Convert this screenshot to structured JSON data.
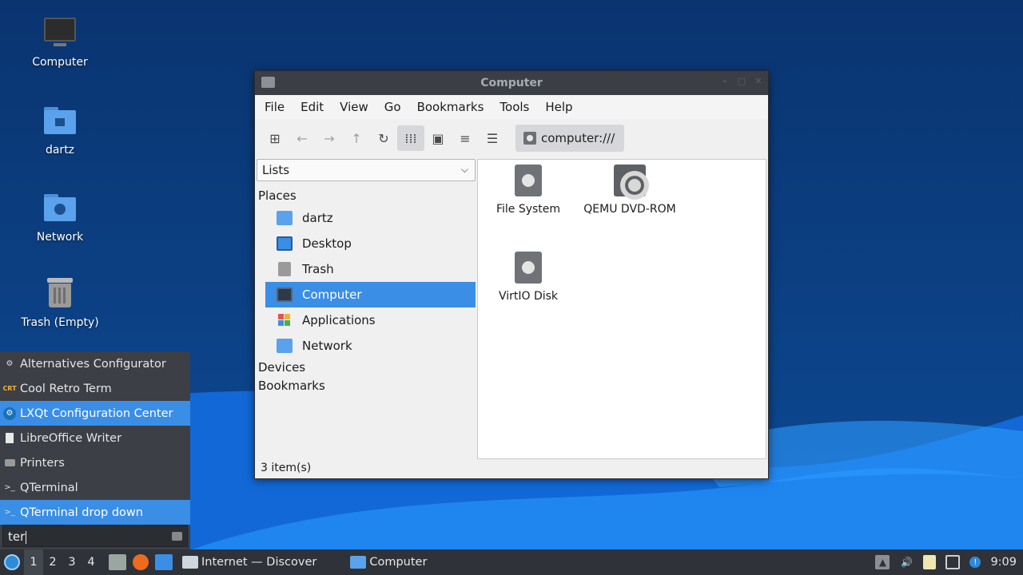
{
  "desktop": {
    "icons": [
      {
        "label": "Computer",
        "icon": "computer-icon"
      },
      {
        "label": "dartz",
        "icon": "home-folder-icon"
      },
      {
        "label": "Network",
        "icon": "network-folder-icon"
      },
      {
        "label": "Trash (Empty)",
        "icon": "trash-icon"
      }
    ]
  },
  "window": {
    "title": "Computer",
    "menu": [
      "File",
      "Edit",
      "View",
      "Go",
      "Bookmarks",
      "Tools",
      "Help"
    ],
    "toolbar": {
      "buttons": [
        "new-tab-icon",
        "back-icon",
        "forward-icon",
        "up-icon",
        "reload-icon",
        "icon-view-icon",
        "thumbnail-view-icon",
        "compact-view-icon",
        "detailed-list-icon"
      ],
      "path": "computer:///"
    },
    "sidebar": {
      "select_value": "Lists",
      "places_header": "Places",
      "items": [
        {
          "label": "dartz",
          "icon": "home-folder-icon"
        },
        {
          "label": "Desktop",
          "icon": "desktop-icon"
        },
        {
          "label": "Trash",
          "icon": "trash-icon"
        },
        {
          "label": "Computer",
          "icon": "computer-icon",
          "selected": true
        },
        {
          "label": "Applications",
          "icon": "applications-icon"
        },
        {
          "label": "Network",
          "icon": "network-folder-icon"
        }
      ],
      "devices_header": "Devices",
      "bookmarks_header": "Bookmarks"
    },
    "files": [
      {
        "label": "File System",
        "icon": "hard-drive-icon"
      },
      {
        "label": "QEMU DVD-ROM",
        "icon": "optical-drive-icon"
      },
      {
        "label": "VirtIO Disk",
        "icon": "hard-drive-icon"
      }
    ],
    "status": "3 item(s)"
  },
  "launcher": {
    "items": [
      {
        "label": "Alternatives Configurator",
        "icon": "configurator-icon"
      },
      {
        "label": "Cool Retro Term",
        "icon": "crt-icon"
      },
      {
        "label": "LXQt Configuration Center",
        "icon": "lxqt-config-icon",
        "highlighted": true
      },
      {
        "label": "LibreOffice Writer",
        "icon": "writer-icon"
      },
      {
        "label": "Printers",
        "icon": "printer-icon"
      },
      {
        "label": "QTerminal",
        "icon": "terminal-icon"
      },
      {
        "label": "QTerminal drop down",
        "icon": "terminal-icon",
        "highlighted": true
      }
    ],
    "search_value": "ter"
  },
  "taskbar": {
    "desktops": [
      "1",
      "2",
      "3",
      "4"
    ],
    "active_desktop": "1",
    "tasks": [
      {
        "label": "Internet — Discover",
        "icon": "discover-icon"
      },
      {
        "label": "Computer",
        "icon": "folder-icon"
      }
    ],
    "clock": "9:09"
  },
  "colors": {
    "accent": "#3a8ee6",
    "desktop_bg": "#0b3a78",
    "panel_bg": "#2f3238"
  }
}
